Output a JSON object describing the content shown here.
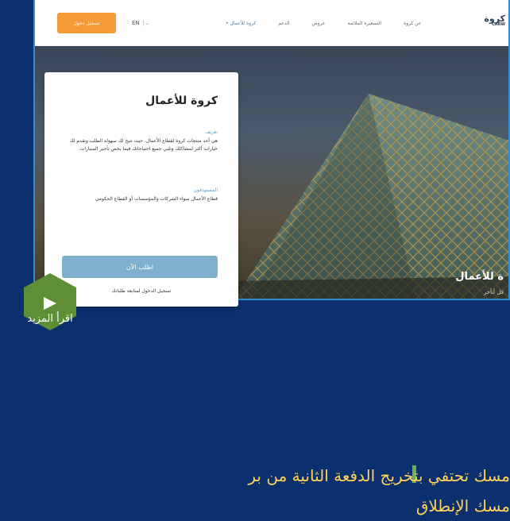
{
  "nav": {
    "login_label": "تسجيل دخول",
    "lang": "EN",
    "links": [
      "كروة للأعمال",
      "الدعم",
      "عروض",
      "التسعيرة الملائمة",
      "عن كروة"
    ],
    "active_index": 0,
    "logo_ar": "كروة",
    "logo_en": "CARW"
  },
  "hero": {
    "title": "ة للأعمال",
    "subtitle": "قل أتأخر"
  },
  "card": {
    "title": "كروة للأعمال",
    "def_label": "تعريف",
    "def_text": "هي أحد منتجات كروة لقطاع الأعمال، حيث تتيح لك سهولة الطلب وتقدم لك خيارات أكثر لمشاكلك وتلبي جميع احتياجاتك فيما يخص تأجير السيارات.",
    "users_label": "المستهدفون",
    "users_text": "قطاع الأعمال سواء الشركات والمؤسسات أو القطاع الحكومي",
    "cta": "اطلب الآن",
    "link": "تسجيل الدخول لمتابعة طلباتك"
  },
  "read_more": "اقرأ المزيد",
  "headline": {
    "line1": "مسك تحتفي بتخريج الدفعة الثانية من بر",
    "line2": "مسك الإنطلاق"
  },
  "colors": {
    "background": "#0c2f6e",
    "accent_orange": "#f59a36",
    "headline_yellow": "#ffd35a",
    "green": "#5e8f37"
  }
}
